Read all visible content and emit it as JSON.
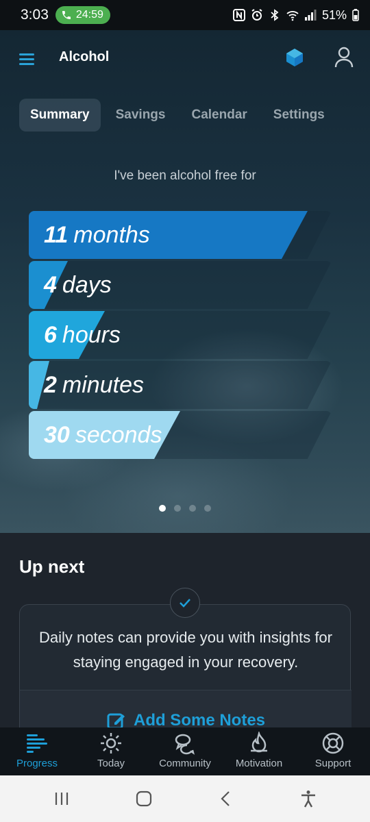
{
  "status_bar": {
    "time": "3:03",
    "call_timer": "24:59",
    "battery": "51%"
  },
  "app_bar": {
    "title": "Alcohol"
  },
  "tabs": [
    {
      "label": "Summary",
      "active": true
    },
    {
      "label": "Savings",
      "active": false
    },
    {
      "label": "Calendar",
      "active": false
    },
    {
      "label": "Settings",
      "active": false
    }
  ],
  "summary": {
    "intro": "I've been alcohol free for",
    "counters": [
      {
        "value": "11",
        "unit": "months",
        "fraction": 0.92,
        "color": "#1678c4"
      },
      {
        "value": "4",
        "unit": "days",
        "fraction": 0.13,
        "color": "#1b8fd0"
      },
      {
        "value": "6",
        "unit": "hours",
        "fraction": 0.25,
        "color": "#20a6dc"
      },
      {
        "value": "2",
        "unit": "minutes",
        "fraction": 0.03,
        "color": "#46b7e4"
      },
      {
        "value": "30",
        "unit": "seconds",
        "fraction": 0.5,
        "color": "#9fd9f0"
      }
    ],
    "page_dots": {
      "count": 4,
      "active": 0
    }
  },
  "up_next": {
    "title": "Up next",
    "card_text": "Daily notes can provide you with insights for staying engaged in your recovery.",
    "action_label": "Add Some Notes"
  },
  "bottom_nav": [
    {
      "label": "Progress",
      "icon": "progress-icon",
      "active": true
    },
    {
      "label": "Today",
      "icon": "sun-icon",
      "active": false
    },
    {
      "label": "Community",
      "icon": "chat-bubbles-icon",
      "active": false
    },
    {
      "label": "Motivation",
      "icon": "flame-icon",
      "active": false
    },
    {
      "label": "Support",
      "icon": "lifebuoy-icon",
      "active": false
    }
  ],
  "colors": {
    "accent": "#1e9fd8",
    "call_green": "#4caf50"
  }
}
